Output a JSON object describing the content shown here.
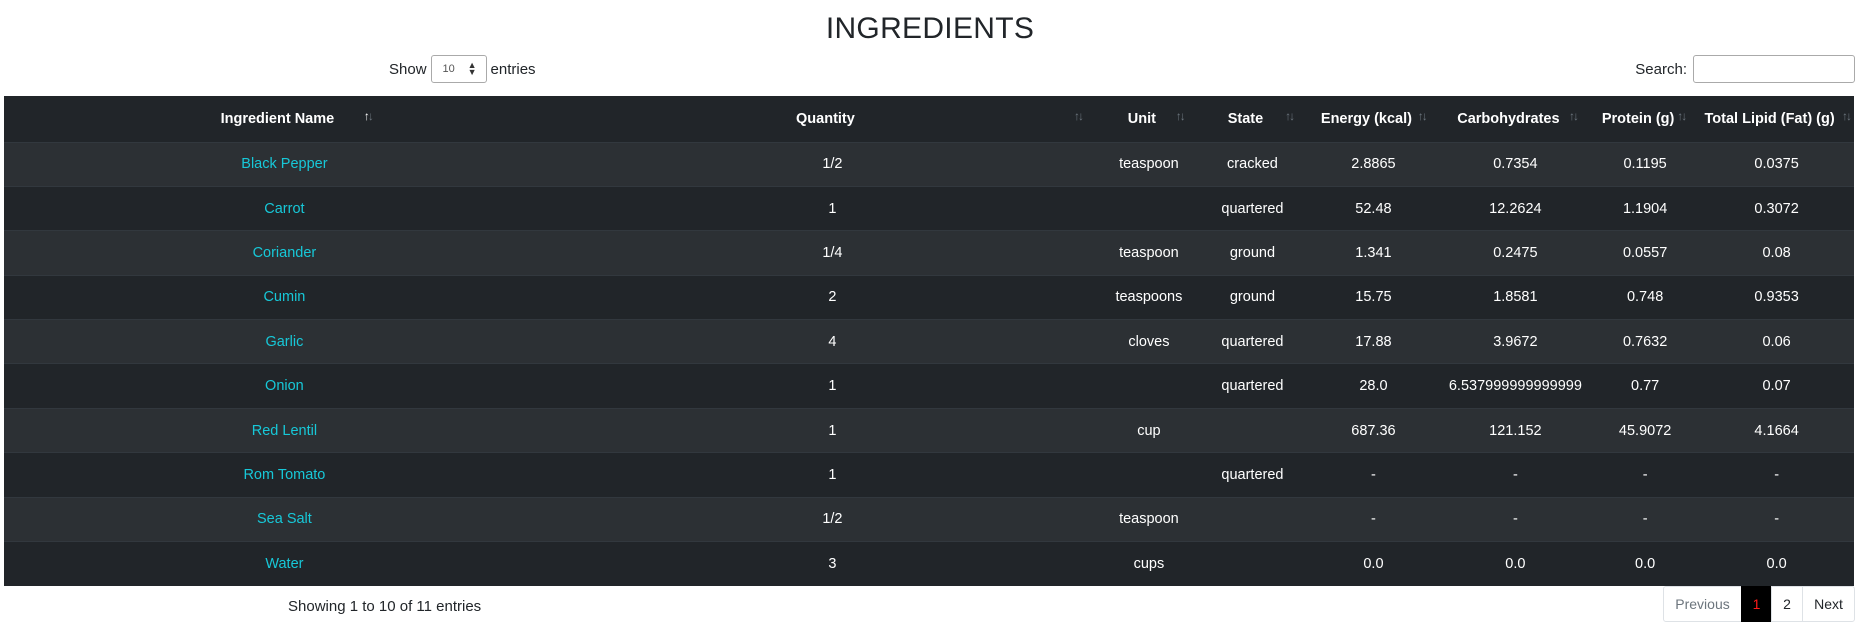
{
  "page": {
    "title": "INGREDIENTS"
  },
  "length": {
    "show_label": "Show",
    "value": "10",
    "entries_label": "entries"
  },
  "search": {
    "label": "Search:",
    "value": ""
  },
  "table": {
    "columns": [
      "Ingredient Name",
      "Quantity",
      "Unit",
      "State",
      "Energy (kcal)",
      "Carbohydrates",
      "Protein (g)",
      "Total Lipid (Fat) (g)"
    ],
    "rows": [
      [
        "Black Pepper",
        "1/2",
        "teaspoon",
        "cracked",
        "2.8865",
        "0.7354",
        "0.1195",
        "0.0375"
      ],
      [
        "Carrot",
        "1",
        "",
        "quartered",
        "52.48",
        "12.2624",
        "1.1904",
        "0.3072"
      ],
      [
        "Coriander",
        "1/4",
        "teaspoon",
        "ground",
        "1.341",
        "0.2475",
        "0.0557",
        "0.08"
      ],
      [
        "Cumin",
        "2",
        "teaspoons",
        "ground",
        "15.75",
        "1.8581",
        "0.748",
        "0.9353"
      ],
      [
        "Garlic",
        "4",
        "cloves",
        "quartered",
        "17.88",
        "3.9672",
        "0.7632",
        "0.06"
      ],
      [
        "Onion",
        "1",
        "",
        "quartered",
        "28.0",
        "6.537999999999999",
        "0.77",
        "0.07"
      ],
      [
        "Red Lentil",
        "1",
        "cup",
        "",
        "687.36",
        "121.152",
        "45.9072",
        "4.1664"
      ],
      [
        "Rom Tomato",
        "1",
        "",
        "quartered",
        "-",
        "-",
        "-",
        "-"
      ],
      [
        "Sea Salt",
        "1/2",
        "teaspoon",
        "",
        "-",
        "-",
        "-",
        "-"
      ],
      [
        "Water",
        "3",
        "cups",
        "",
        "0.0",
        "0.0",
        "0.0",
        "0.0"
      ]
    ]
  },
  "info": "Showing 1 to 10 of 11 entries",
  "pagination": {
    "previous": "Previous",
    "pages": [
      "1",
      "2"
    ],
    "current": "1",
    "next": "Next"
  },
  "colors": {
    "header_bg": "#212529",
    "row_odd": "#2c3034",
    "row_even": "#212529",
    "link": "#17c8d8",
    "active_page_text": "#ff1a1a"
  },
  "icons": {
    "sort": "sort-arrows-icon",
    "select": "select-arrows-icon"
  }
}
